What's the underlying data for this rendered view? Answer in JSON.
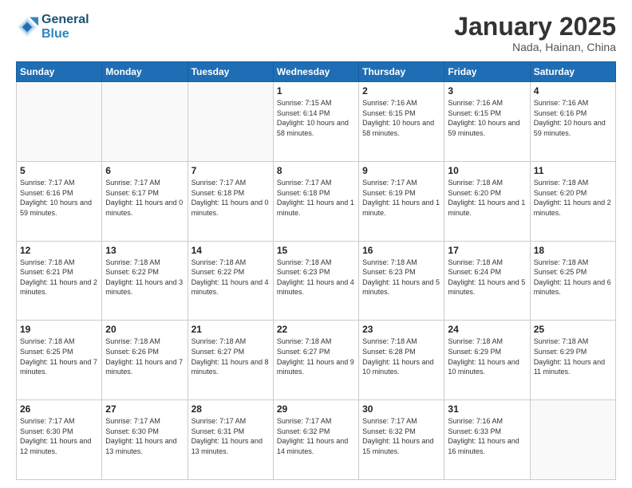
{
  "header": {
    "logo_line1": "General",
    "logo_line2": "Blue",
    "title": "January 2025",
    "subtitle": "Nada, Hainan, China"
  },
  "days_of_week": [
    "Sunday",
    "Monday",
    "Tuesday",
    "Wednesday",
    "Thursday",
    "Friday",
    "Saturday"
  ],
  "weeks": [
    [
      {
        "day": "",
        "sunrise": "",
        "sunset": "",
        "daylight": ""
      },
      {
        "day": "",
        "sunrise": "",
        "sunset": "",
        "daylight": ""
      },
      {
        "day": "",
        "sunrise": "",
        "sunset": "",
        "daylight": ""
      },
      {
        "day": "1",
        "sunrise": "Sunrise: 7:15 AM",
        "sunset": "Sunset: 6:14 PM",
        "daylight": "Daylight: 10 hours and 58 minutes."
      },
      {
        "day": "2",
        "sunrise": "Sunrise: 7:16 AM",
        "sunset": "Sunset: 6:15 PM",
        "daylight": "Daylight: 10 hours and 58 minutes."
      },
      {
        "day": "3",
        "sunrise": "Sunrise: 7:16 AM",
        "sunset": "Sunset: 6:15 PM",
        "daylight": "Daylight: 10 hours and 59 minutes."
      },
      {
        "day": "4",
        "sunrise": "Sunrise: 7:16 AM",
        "sunset": "Sunset: 6:16 PM",
        "daylight": "Daylight: 10 hours and 59 minutes."
      }
    ],
    [
      {
        "day": "5",
        "sunrise": "Sunrise: 7:17 AM",
        "sunset": "Sunset: 6:16 PM",
        "daylight": "Daylight: 10 hours and 59 minutes."
      },
      {
        "day": "6",
        "sunrise": "Sunrise: 7:17 AM",
        "sunset": "Sunset: 6:17 PM",
        "daylight": "Daylight: 11 hours and 0 minutes."
      },
      {
        "day": "7",
        "sunrise": "Sunrise: 7:17 AM",
        "sunset": "Sunset: 6:18 PM",
        "daylight": "Daylight: 11 hours and 0 minutes."
      },
      {
        "day": "8",
        "sunrise": "Sunrise: 7:17 AM",
        "sunset": "Sunset: 6:18 PM",
        "daylight": "Daylight: 11 hours and 1 minute."
      },
      {
        "day": "9",
        "sunrise": "Sunrise: 7:17 AM",
        "sunset": "Sunset: 6:19 PM",
        "daylight": "Daylight: 11 hours and 1 minute."
      },
      {
        "day": "10",
        "sunrise": "Sunrise: 7:18 AM",
        "sunset": "Sunset: 6:20 PM",
        "daylight": "Daylight: 11 hours and 1 minute."
      },
      {
        "day": "11",
        "sunrise": "Sunrise: 7:18 AM",
        "sunset": "Sunset: 6:20 PM",
        "daylight": "Daylight: 11 hours and 2 minutes."
      }
    ],
    [
      {
        "day": "12",
        "sunrise": "Sunrise: 7:18 AM",
        "sunset": "Sunset: 6:21 PM",
        "daylight": "Daylight: 11 hours and 2 minutes."
      },
      {
        "day": "13",
        "sunrise": "Sunrise: 7:18 AM",
        "sunset": "Sunset: 6:22 PM",
        "daylight": "Daylight: 11 hours and 3 minutes."
      },
      {
        "day": "14",
        "sunrise": "Sunrise: 7:18 AM",
        "sunset": "Sunset: 6:22 PM",
        "daylight": "Daylight: 11 hours and 4 minutes."
      },
      {
        "day": "15",
        "sunrise": "Sunrise: 7:18 AM",
        "sunset": "Sunset: 6:23 PM",
        "daylight": "Daylight: 11 hours and 4 minutes."
      },
      {
        "day": "16",
        "sunrise": "Sunrise: 7:18 AM",
        "sunset": "Sunset: 6:23 PM",
        "daylight": "Daylight: 11 hours and 5 minutes."
      },
      {
        "day": "17",
        "sunrise": "Sunrise: 7:18 AM",
        "sunset": "Sunset: 6:24 PM",
        "daylight": "Daylight: 11 hours and 5 minutes."
      },
      {
        "day": "18",
        "sunrise": "Sunrise: 7:18 AM",
        "sunset": "Sunset: 6:25 PM",
        "daylight": "Daylight: 11 hours and 6 minutes."
      }
    ],
    [
      {
        "day": "19",
        "sunrise": "Sunrise: 7:18 AM",
        "sunset": "Sunset: 6:25 PM",
        "daylight": "Daylight: 11 hours and 7 minutes."
      },
      {
        "day": "20",
        "sunrise": "Sunrise: 7:18 AM",
        "sunset": "Sunset: 6:26 PM",
        "daylight": "Daylight: 11 hours and 7 minutes."
      },
      {
        "day": "21",
        "sunrise": "Sunrise: 7:18 AM",
        "sunset": "Sunset: 6:27 PM",
        "daylight": "Daylight: 11 hours and 8 minutes."
      },
      {
        "day": "22",
        "sunrise": "Sunrise: 7:18 AM",
        "sunset": "Sunset: 6:27 PM",
        "daylight": "Daylight: 11 hours and 9 minutes."
      },
      {
        "day": "23",
        "sunrise": "Sunrise: 7:18 AM",
        "sunset": "Sunset: 6:28 PM",
        "daylight": "Daylight: 11 hours and 10 minutes."
      },
      {
        "day": "24",
        "sunrise": "Sunrise: 7:18 AM",
        "sunset": "Sunset: 6:29 PM",
        "daylight": "Daylight: 11 hours and 10 minutes."
      },
      {
        "day": "25",
        "sunrise": "Sunrise: 7:18 AM",
        "sunset": "Sunset: 6:29 PM",
        "daylight": "Daylight: 11 hours and 11 minutes."
      }
    ],
    [
      {
        "day": "26",
        "sunrise": "Sunrise: 7:17 AM",
        "sunset": "Sunset: 6:30 PM",
        "daylight": "Daylight: 11 hours and 12 minutes."
      },
      {
        "day": "27",
        "sunrise": "Sunrise: 7:17 AM",
        "sunset": "Sunset: 6:30 PM",
        "daylight": "Daylight: 11 hours and 13 minutes."
      },
      {
        "day": "28",
        "sunrise": "Sunrise: 7:17 AM",
        "sunset": "Sunset: 6:31 PM",
        "daylight": "Daylight: 11 hours and 13 minutes."
      },
      {
        "day": "29",
        "sunrise": "Sunrise: 7:17 AM",
        "sunset": "Sunset: 6:32 PM",
        "daylight": "Daylight: 11 hours and 14 minutes."
      },
      {
        "day": "30",
        "sunrise": "Sunrise: 7:17 AM",
        "sunset": "Sunset: 6:32 PM",
        "daylight": "Daylight: 11 hours and 15 minutes."
      },
      {
        "day": "31",
        "sunrise": "Sunrise: 7:16 AM",
        "sunset": "Sunset: 6:33 PM",
        "daylight": "Daylight: 11 hours and 16 minutes."
      },
      {
        "day": "",
        "sunrise": "",
        "sunset": "",
        "daylight": ""
      }
    ]
  ]
}
